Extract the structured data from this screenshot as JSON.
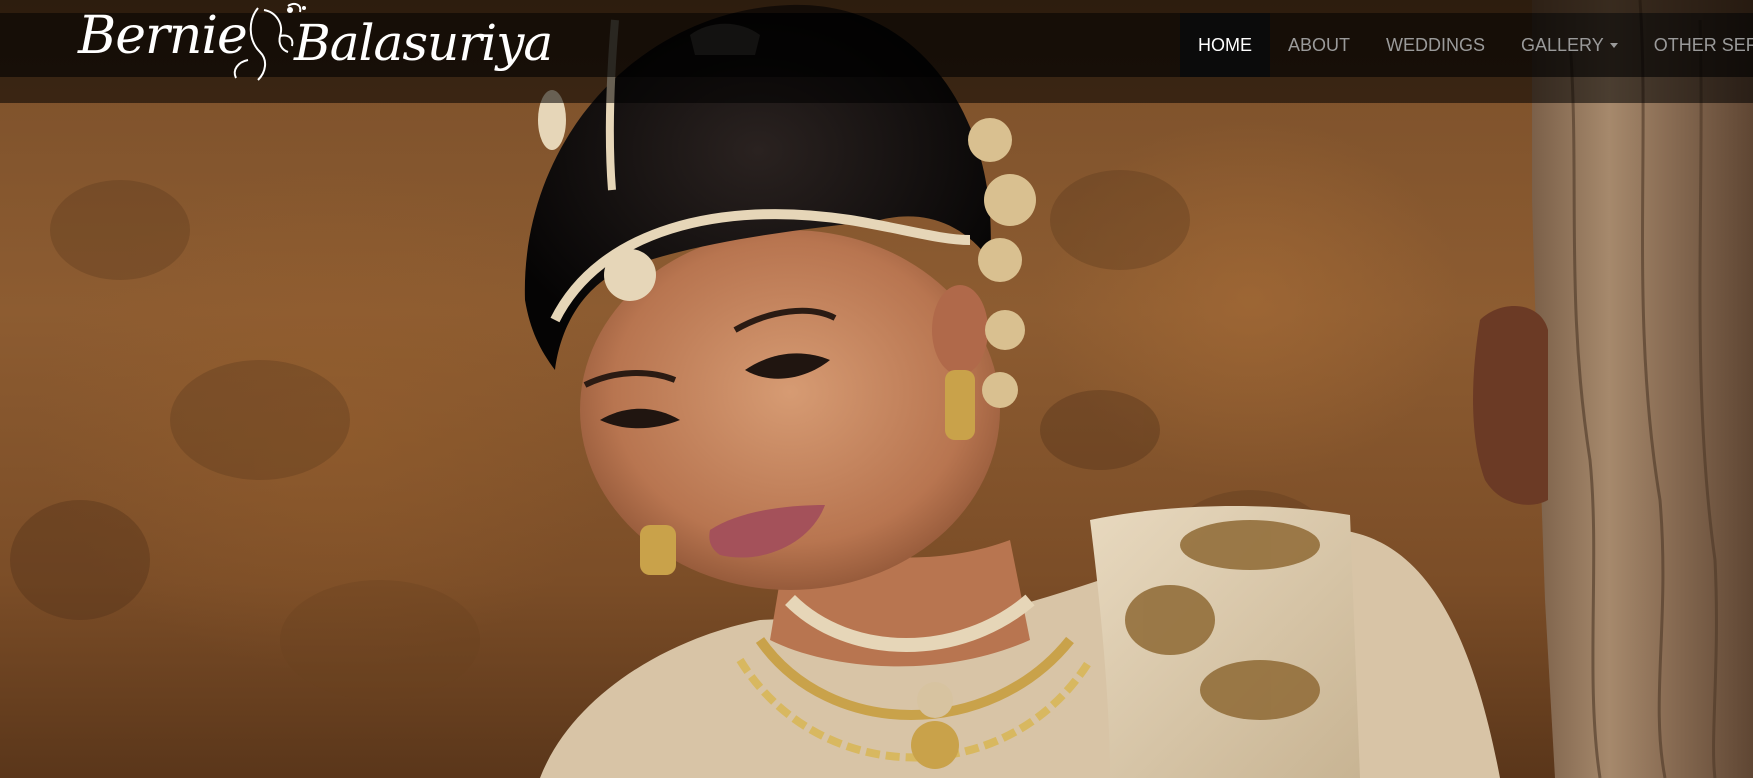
{
  "brand": {
    "first": "Bernie",
    "last": "Balasuriya",
    "logo_icon": "flourish-portrait-icon"
  },
  "nav": {
    "items": [
      {
        "label": "HOME",
        "active": true
      },
      {
        "label": "ABOUT",
        "active": false
      },
      {
        "label": "WEDDINGS",
        "active": false
      },
      {
        "label": "GALLERY",
        "active": false,
        "dropdown": true
      },
      {
        "label": "OTHER SERVICES",
        "active": false
      }
    ]
  },
  "hero": {
    "subject": "bridal-portrait-photo"
  },
  "colors": {
    "navbar_bg": "#000000",
    "nav_text": "#9a9a9a",
    "nav_active_text": "#ffffff",
    "nav_active_bg": "#0b0b0b"
  }
}
